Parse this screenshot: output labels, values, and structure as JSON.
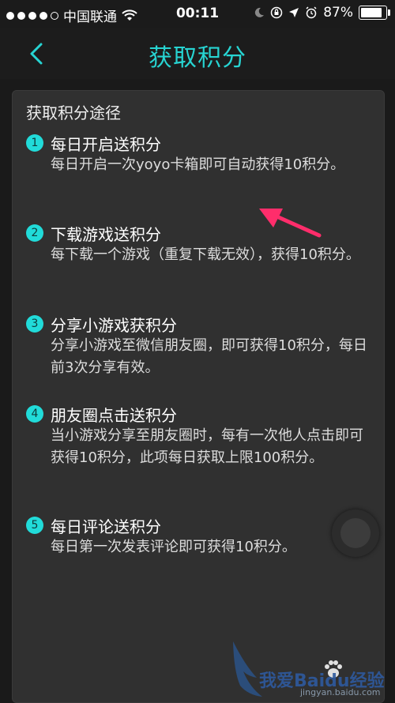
{
  "status_bar": {
    "carrier": "中国联通",
    "time": "00:11",
    "battery": "87%"
  },
  "nav": {
    "title": "获取积分",
    "back_icon": "chevron-left-icon"
  },
  "card": {
    "heading": "获取积分途径",
    "items": [
      {
        "num": "1",
        "title": "每日开启送积分",
        "desc": "每日开启一次yoyo卡箱即可自动获得10积分。"
      },
      {
        "num": "2",
        "title": "下载游戏送积分",
        "desc": "每下载一个游戏（重复下载无效），获得10积分。"
      },
      {
        "num": "3",
        "title": "分享小游戏获积分",
        "desc": "分享小游戏至微信朋友圈，即可获得10积分，每日前3次分享有效。"
      },
      {
        "num": "4",
        "title": "朋友圈点击送积分",
        "desc": "当小游戏分享至朋友圈时，每有一次他人点击即可获得10积分，此项每日获取上限100积分。"
      },
      {
        "num": "5",
        "title": "每日评论送积分",
        "desc": "每日第一次发表评论即可获得10积分。"
      }
    ]
  },
  "watermark": {
    "text": "我爱Baidu经验",
    "url": "jingyan.baidu.com"
  },
  "colors": {
    "accent": "#27d4d2",
    "arrow": "#ff2d6b"
  }
}
